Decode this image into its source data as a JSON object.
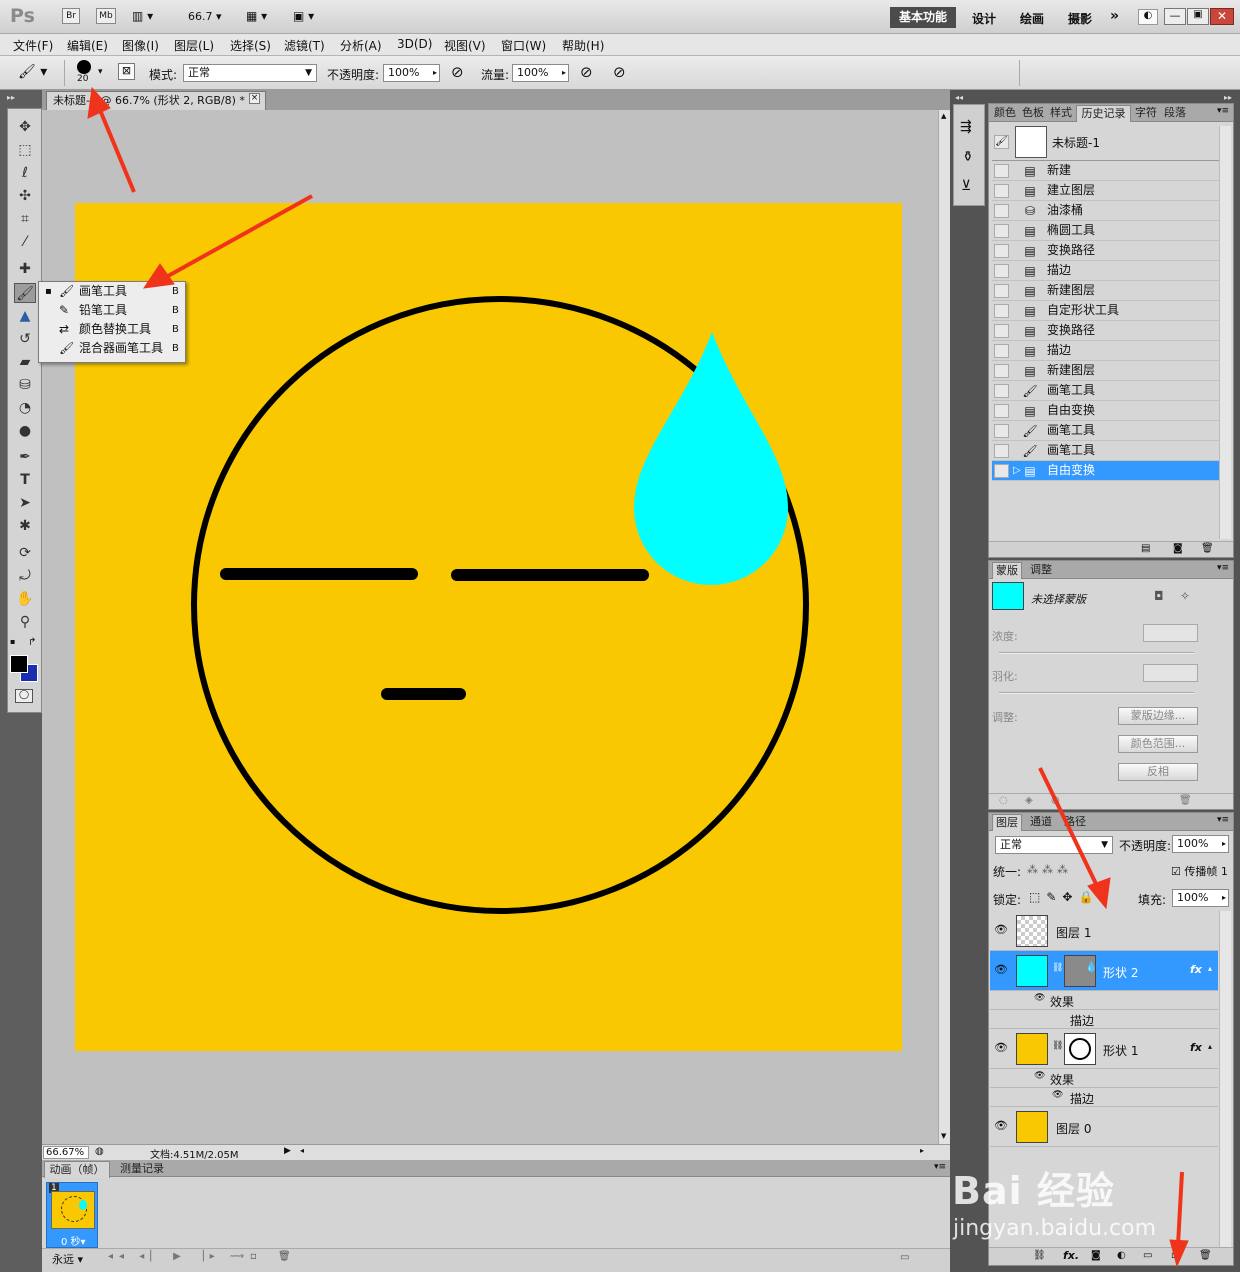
{
  "app": {
    "logo": "Ps",
    "br": "Br",
    "mb": "Mb",
    "zoom_menu": "66.7",
    "workspaces": [
      "基本功能",
      "设计",
      "绘画",
      "摄影"
    ],
    "more": "»"
  },
  "menu": [
    "文件(F)",
    "编辑(E)",
    "图像(I)",
    "图层(L)",
    "选择(S)",
    "滤镜(T)",
    "分析(A)",
    "3D(D)",
    "视图(V)",
    "窗口(W)",
    "帮助(H)"
  ],
  "options": {
    "brush_size": "20",
    "mode_label": "模式:",
    "mode_value": "正常",
    "opacity_label": "不透明度:",
    "opacity_value": "100%",
    "flow_label": "流量:",
    "flow_value": "100%"
  },
  "document": {
    "tab_title": "未标题-1 @ 66.7% (形状 2, RGB/8) *",
    "tab_close": "×"
  },
  "context_menu": [
    {
      "label": "画笔工具",
      "key": "B",
      "icon": "brush-icon",
      "checked": true
    },
    {
      "label": "铅笔工具",
      "key": "B",
      "icon": "pencil-icon",
      "checked": false
    },
    {
      "label": "颜色替换工具",
      "key": "B",
      "icon": "color-replace-icon",
      "checked": false
    },
    {
      "label": "混合器画笔工具",
      "key": "B",
      "icon": "mixer-brush-icon",
      "checked": false
    }
  ],
  "status": {
    "zoom": "66.67%",
    "doc": "文档:4.51M/2.05M"
  },
  "animation": {
    "tabs": [
      "动画（帧）",
      "测量记录"
    ],
    "frame_number": "1",
    "frame_delay": "0 秒",
    "loop": "永远"
  },
  "history": {
    "tabs": [
      "颜色",
      "色板",
      "样式",
      "历史记录",
      "字符",
      "段落"
    ],
    "snapshot": "未标题-1",
    "items": [
      "新建",
      "建立图层",
      "油漆桶",
      "椭圆工具",
      "变换路径",
      "描边",
      "新建图层",
      "自定形状工具",
      "变换路径",
      "描边",
      "新建图层",
      "画笔工具",
      "自由变换",
      "画笔工具",
      "画笔工具",
      "自由变换"
    ],
    "selected_index": 15
  },
  "masks": {
    "tabs": [
      "蒙版",
      "调整"
    ],
    "title": "未选择蒙版",
    "density_label": "浓度:",
    "feather_label": "羽化:",
    "refine_label": "调整:",
    "buttons": [
      "蒙版边缘...",
      "颜色范围...",
      "反相"
    ]
  },
  "layers": {
    "tabs": [
      "图层",
      "通道",
      "路径"
    ],
    "blend_mode": "正常",
    "opacity_label": "不透明度:",
    "opacity_value": "100%",
    "unify_label": "统一:",
    "propagate_label": "传播帧",
    "propagate_num": "1",
    "lock_label": "锁定:",
    "fill_label": "填充:",
    "fill_value": "100%",
    "items": [
      {
        "name": "图层 1"
      },
      {
        "name": "形状 2",
        "fx": "fx",
        "effects": "效果",
        "stroke": "描边"
      },
      {
        "name": "形状 1",
        "fx": "fx",
        "effects": "效果",
        "stroke": "描边"
      },
      {
        "name": "图层 0"
      }
    ]
  },
  "watermark": {
    "main": "Bai 经验",
    "sub": "jingyan.baidu.com"
  },
  "colors": {
    "canvas_yellow": "#f9c800",
    "drop_cyan": "#00ffff",
    "selection_blue": "#3399ff",
    "arrow_red": "#f0341c"
  }
}
